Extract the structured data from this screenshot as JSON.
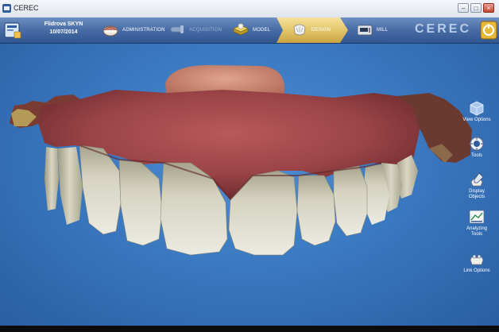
{
  "window": {
    "title": "CEREC"
  },
  "patient": {
    "name": "Flidrova SKYN",
    "date": "10/07/2014"
  },
  "phases": [
    {
      "label": "ADMINISTRATION",
      "state": "normal"
    },
    {
      "label": "ACQUISITION",
      "state": "disabled"
    },
    {
      "label": "MODEL",
      "state": "normal"
    },
    {
      "label": "DESIGN",
      "state": "active"
    },
    {
      "label": "MILL",
      "state": "normal"
    }
  ],
  "brand": {
    "logo_text": "CEREC"
  },
  "side_tools": [
    {
      "label": "View Options",
      "icon": "view-options-icon"
    },
    {
      "label": "Tools",
      "icon": "tools-icon"
    },
    {
      "label": "Display Objects",
      "icon": "display-objects-icon"
    },
    {
      "label": "Analyzing Tools",
      "icon": "analyzing-tools-icon"
    },
    {
      "label": "Link Options",
      "icon": "link-options-icon"
    }
  ],
  "colors": {
    "toolbar": "#4a6fa8",
    "active_phase": "#e3c56a",
    "viewport_bg": "#3b79c1",
    "gum": "#a04a4a",
    "tooth": "#d8d5c2"
  }
}
